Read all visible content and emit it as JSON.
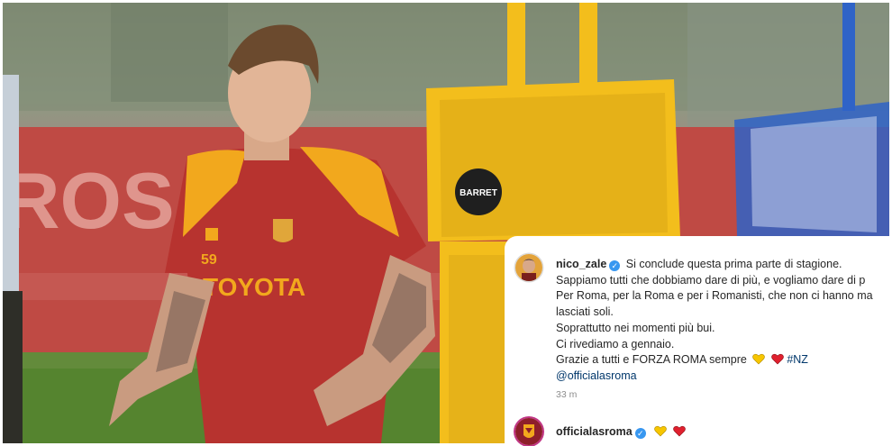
{
  "photo": {
    "banner_text": "ROS",
    "shirt_sponsor": "TOYOTA",
    "shirt_number": "59",
    "dummy_brand": "BARRET",
    "colors": {
      "jersey": "#b7332f",
      "jersey_shoulder": "#f2a81d",
      "dummy": "#f3be1c",
      "banner": "#bd4d48",
      "grass": "#55842f"
    }
  },
  "post": {
    "author": "nico_zale",
    "caption_lines": [
      "Si conclude questa prima parte di stagione.",
      "Sappiamo tutti che dobbiamo dare di più, e vogliamo dare di p",
      "Per Roma, per la Roma e per i Romanisti, che non ci hanno ma",
      "lasciati soli.",
      "Soprattutto nei momenti più bui.",
      "Ci rivediamo a gennaio.",
      "Grazie a tutti e FORZA ROMA sempre"
    ],
    "hashtag": "#NZ",
    "mention": "@officialasroma",
    "timestamp": "33 m",
    "emojis": [
      "yellow-heart",
      "red-heart"
    ]
  },
  "comment": {
    "author": "officialasroma",
    "emojis": [
      "yellow-heart",
      "red-heart"
    ]
  },
  "ui_colors": {
    "verified": "#3897f0",
    "link": "#00376b",
    "muted": "#8e8e8e",
    "text": "#262626"
  }
}
